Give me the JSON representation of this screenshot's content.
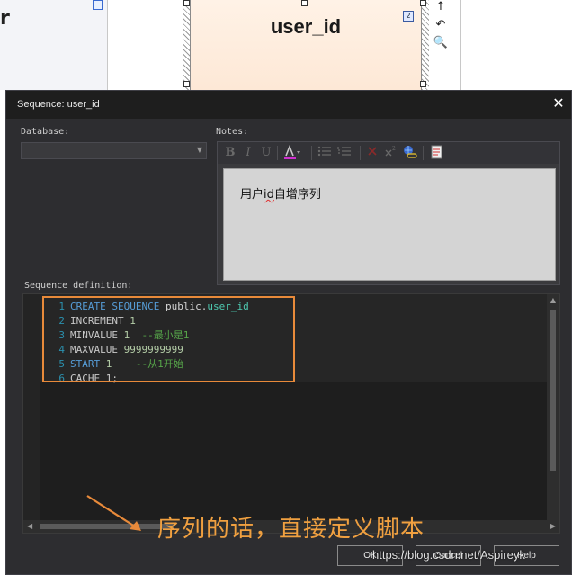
{
  "background": {
    "left_panel_text": "r",
    "entity_title": "user_id",
    "entity_badge": "2",
    "tools": [
      "↑",
      "↶",
      "🔍"
    ]
  },
  "dialog": {
    "title": "Sequence: user_id",
    "close_symbol": "✕",
    "database_label": "Database:",
    "database_value": "",
    "notes_label": "Notes:",
    "notes": {
      "prefix": "用户",
      "squiggle": "id",
      "suffix": "自增序列"
    },
    "toolbar": {
      "bold": "B",
      "italic": "I",
      "underline": "U"
    },
    "sequence_label": "Sequence definition:",
    "code_lines": [
      {
        "num": "1",
        "kw": "CREATE SEQUENCE ",
        "schema": "public",
        "dot": ".",
        "name": "user_id"
      },
      {
        "num": "2",
        "kw": "INCREMENT ",
        "val": "1",
        "comment": ""
      },
      {
        "num": "3",
        "kw": "MINVALUE ",
        "val": "1",
        "comment": "  --最小是1"
      },
      {
        "num": "4",
        "kw": "MAXVALUE ",
        "val": "9999999999",
        "comment": ""
      },
      {
        "num": "5",
        "kw": "START ",
        "val": "1",
        "comment": "    --从1开始"
      },
      {
        "num": "6",
        "kw": "CACHE ",
        "val": "1;",
        "comment": ""
      }
    ],
    "annotation": "序列的话，直接定义脚本",
    "buttons": {
      "ok": "OK",
      "cancel": "Cancel",
      "help": "Help"
    },
    "watermark": "https://blog.csdn.net/Aspireyk"
  },
  "colors": {
    "accent_orange": "#e88a3a",
    "annotation_orange": "#f0a040",
    "keyword_blue": "#569cd6",
    "comment_green": "#57a64a"
  }
}
